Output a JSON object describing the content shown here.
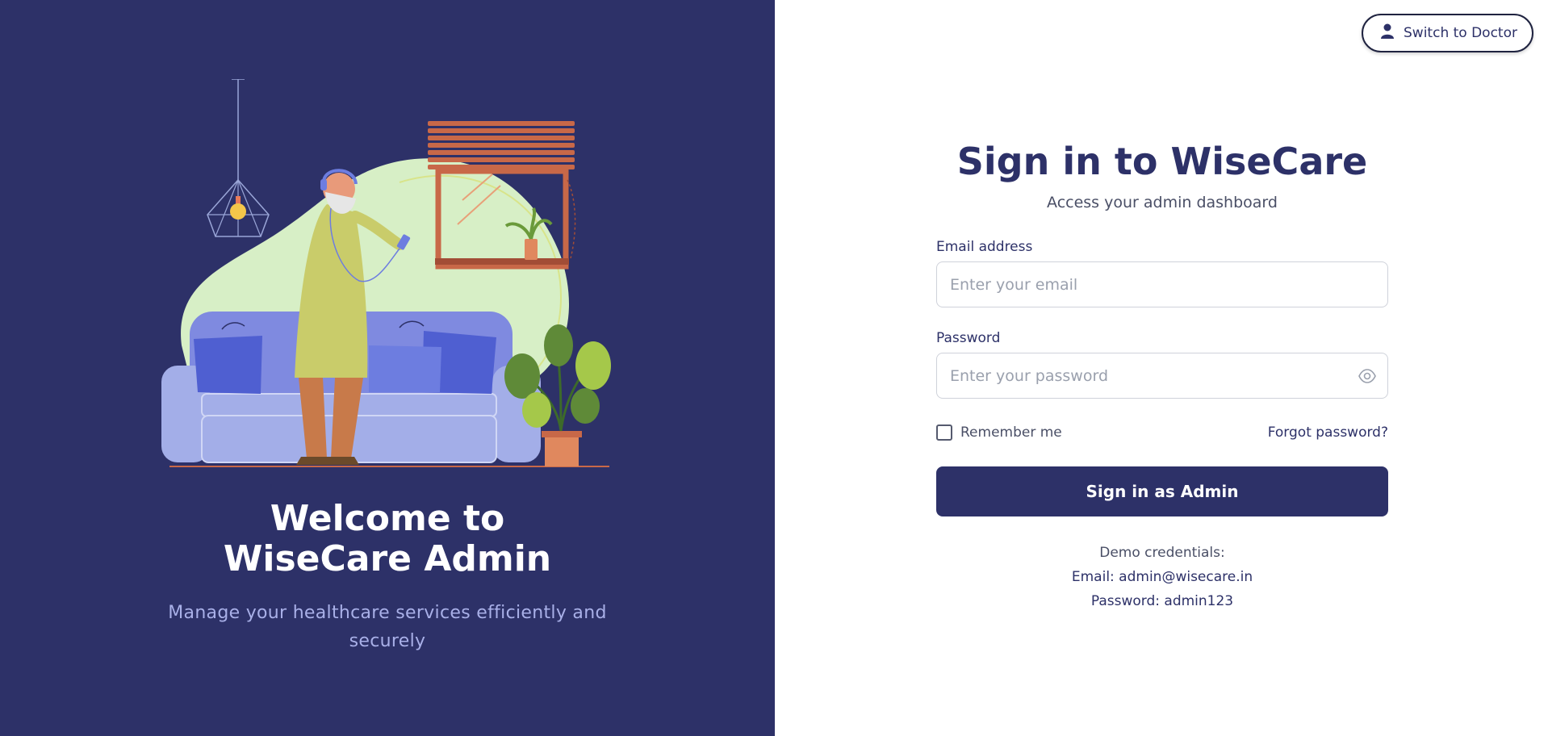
{
  "left": {
    "welcome_title": "Welcome to WiseCare Admin",
    "welcome_subtitle": "Manage your healthcare services efficiently and securely"
  },
  "header": {
    "switch_label": "Switch to Doctor"
  },
  "form": {
    "title": "Sign in to WiseCare",
    "subtitle": "Access your admin dashboard",
    "email_label": "Email address",
    "email_placeholder": "Enter your email",
    "email_value": "",
    "password_label": "Password",
    "password_placeholder": "Enter your password",
    "password_value": "",
    "remember_label": "Remember me",
    "remember_checked": false,
    "forgot_label": "Forgot password?",
    "submit_label": "Sign in as Admin"
  },
  "demo": {
    "heading": "Demo credentials:",
    "email_line": "Email: admin@wisecare.in",
    "password_line": "Password: admin123"
  },
  "colors": {
    "brand_navy": "#2d3168",
    "muted_text": "#4a4f66",
    "accent_light": "#a9b0e8"
  },
  "icons": {
    "switch": "user-icon",
    "password_toggle": "eye-icon"
  }
}
